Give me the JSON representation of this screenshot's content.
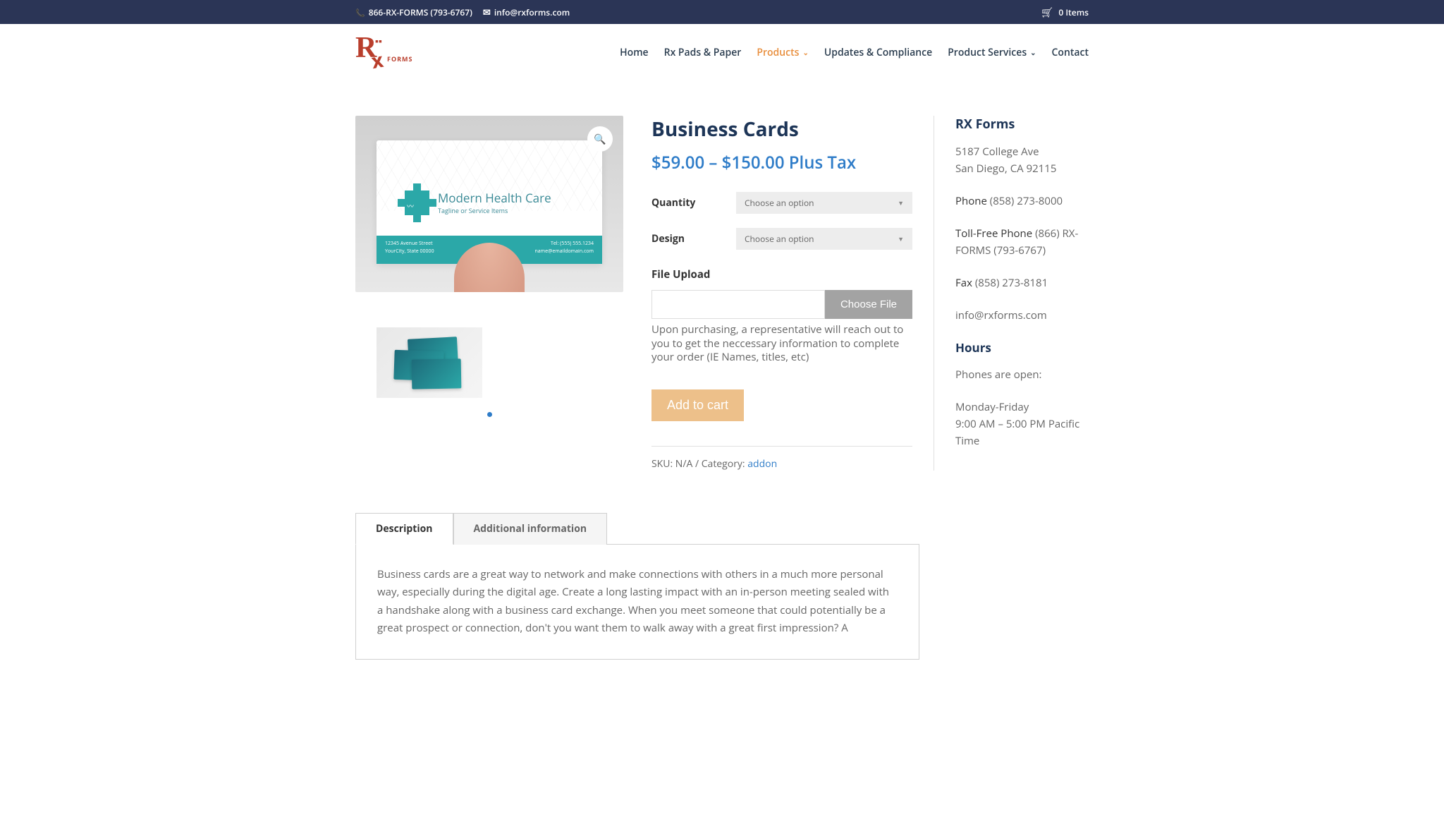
{
  "topbar": {
    "phone": "866-RX-FORMS (793-6767)",
    "email": "info@rxforms.com",
    "cart": "0 Items"
  },
  "logo": {
    "text": "FORMS"
  },
  "nav": [
    {
      "label": "Home",
      "active": false,
      "dropdown": false
    },
    {
      "label": "Rx Pads & Paper",
      "active": false,
      "dropdown": false
    },
    {
      "label": "Products",
      "active": true,
      "dropdown": true
    },
    {
      "label": "Updates & Compliance",
      "active": false,
      "dropdown": false
    },
    {
      "label": "Product Services",
      "active": false,
      "dropdown": true
    },
    {
      "label": "Contact",
      "active": false,
      "dropdown": false
    }
  ],
  "product": {
    "title": "Business Cards",
    "price": "$59.00 – $150.00 Plus Tax",
    "card_sample": {
      "name": "Modern Health Care",
      "tagline": "Tagline or Service Items",
      "address1": "12345 Avenue Street",
      "address2": "YourCity, State 00000",
      "tel": "Tel: (555) 555.1234",
      "email": "name@emaildomain.com"
    },
    "variations": {
      "quantity_label": "Quantity",
      "quantity_placeholder": "Choose an option",
      "design_label": "Design",
      "design_placeholder": "Choose an option"
    },
    "file_upload": {
      "label": "File Upload",
      "button": "Choose File",
      "note": "Upon purchasing, a representative will reach out to you to get the neccessary information to complete your order (IE Names, titles, etc)"
    },
    "add_to_cart": "Add to cart",
    "meta": {
      "sku_label": "SKU: ",
      "sku_value": "N/A",
      "category_label": " / Category: ",
      "category_value": "addon"
    }
  },
  "sidebar": {
    "title": "RX Forms",
    "address1": "5187 College Ave",
    "address2": "San Diego, CA 92115",
    "phone_label": "Phone ",
    "phone_value": "(858) 273-8000",
    "tollfree_label": "Toll-Free Phone ",
    "tollfree_value": "(866) RX-FORMS (793-6767)",
    "fax_label": "Fax ",
    "fax_value": "(858) 273-8181",
    "email": "info@rxforms.com",
    "hours_title": "Hours",
    "hours_label": "Phones are open:",
    "hours_days": "Monday-Friday",
    "hours_time": "9:00 AM – 5:00 PM Pacific Time"
  },
  "tabs": {
    "description_label": "Description",
    "additional_label": "Additional information",
    "description_content": "Business cards are a great way to network and make connections with others in a much more personal way, especially during the digital age. Create a long lasting impact with an in-person meeting sealed with a handshake along with a business card exchange. When you meet someone that could potentially be a great prospect or connection, don't you want them to walk away with a great first impression? A"
  }
}
